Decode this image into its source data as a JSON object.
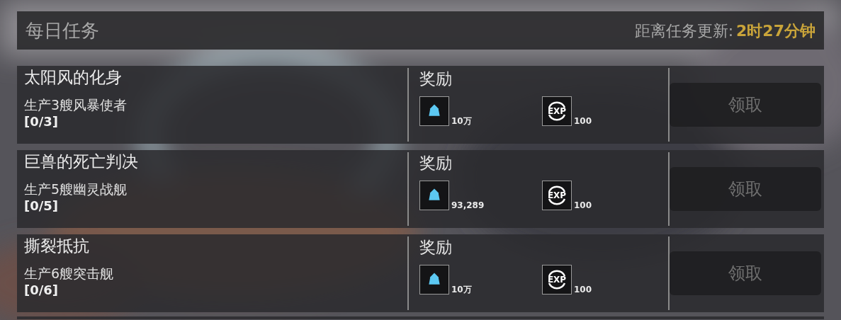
{
  "header": {
    "title": "每日任务",
    "refresh_label": "距离任务更新:",
    "refresh_time": "2时27分钟"
  },
  "tasks": [
    {
      "name": "太阳风的化身",
      "description": "生产3艘风暴使者",
      "progress": "[0/3]",
      "reward_label": "奖励",
      "rewards": [
        {
          "kind": "crystal",
          "amount": "10万"
        },
        {
          "kind": "exp",
          "icon_text": "EXP",
          "amount": "100"
        }
      ],
      "button": "领取",
      "disabled": true
    },
    {
      "name": "巨兽的死亡判决",
      "description": "生产5艘幽灵战舰",
      "progress": "[0/5]",
      "reward_label": "奖励",
      "rewards": [
        {
          "kind": "crystal",
          "amount": "93,289"
        },
        {
          "kind": "exp",
          "icon_text": "EXP",
          "amount": "100"
        }
      ],
      "button": "领取",
      "disabled": true
    },
    {
      "name": "撕裂抵抗",
      "description": "生产6艘突击舰",
      "progress": "[0/6]",
      "reward_label": "奖励",
      "rewards": [
        {
          "kind": "crystal",
          "amount": "10万"
        },
        {
          "kind": "exp",
          "icon_text": "EXP",
          "amount": "100"
        }
      ],
      "button": "领取",
      "disabled": true
    }
  ]
}
